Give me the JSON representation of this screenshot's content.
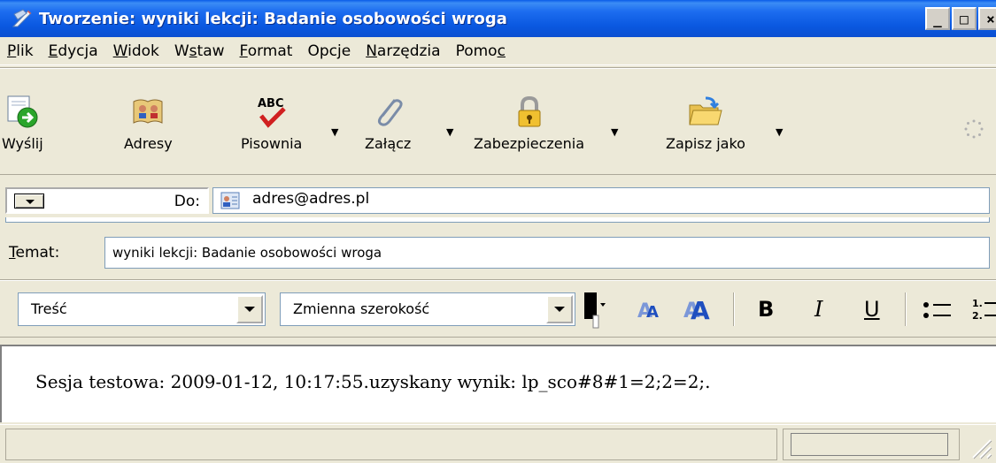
{
  "window": {
    "title": "Tworzenie: wyniki lekcji: Badanie osobowości wroga",
    "min_glyph": "_",
    "max_glyph": "□",
    "close_glyph": "×"
  },
  "menu": [
    {
      "underlined": "P",
      "rest": "lik"
    },
    {
      "underlined": "E",
      "rest": "dycja"
    },
    {
      "underlined": "W",
      "rest": "idok"
    },
    {
      "pre": "W",
      "underlined": "s",
      "rest": "taw"
    },
    {
      "underlined": "F",
      "rest": "ormat"
    },
    {
      "pre": "Opc",
      "underlined": "j",
      "rest": "e"
    },
    {
      "underlined": "N",
      "rest": "arzędzia"
    },
    {
      "pre": "Pomo",
      "underlined": "c",
      "rest": ""
    }
  ],
  "toolbar": {
    "send": "Wyślij",
    "addresses": "Adresy",
    "spelling": "Pisownia",
    "attach": "Załącz",
    "security": "Zabezpieczenia",
    "save_as": "Zapisz jako"
  },
  "to": {
    "label": "Do:",
    "value": "adres@adres.pl"
  },
  "subject": {
    "label_underlined": "T",
    "label_rest": "emat:",
    "value": "wyniki lekcji: Badanie osobowości wroga"
  },
  "format": {
    "style": "Treść",
    "font": "Zmienna szerokość",
    "bold": "B",
    "italic": "I",
    "underline": "U"
  },
  "body": {
    "text": "Sesja testowa: 2009-01-12, 10:17:55.uzyskany wynik: lp_sco#8#1=2;2=2;."
  },
  "colors": {
    "title_bar": "#0a58e0",
    "chrome": "#ece9d8",
    "field_border": "#7f9db9"
  }
}
